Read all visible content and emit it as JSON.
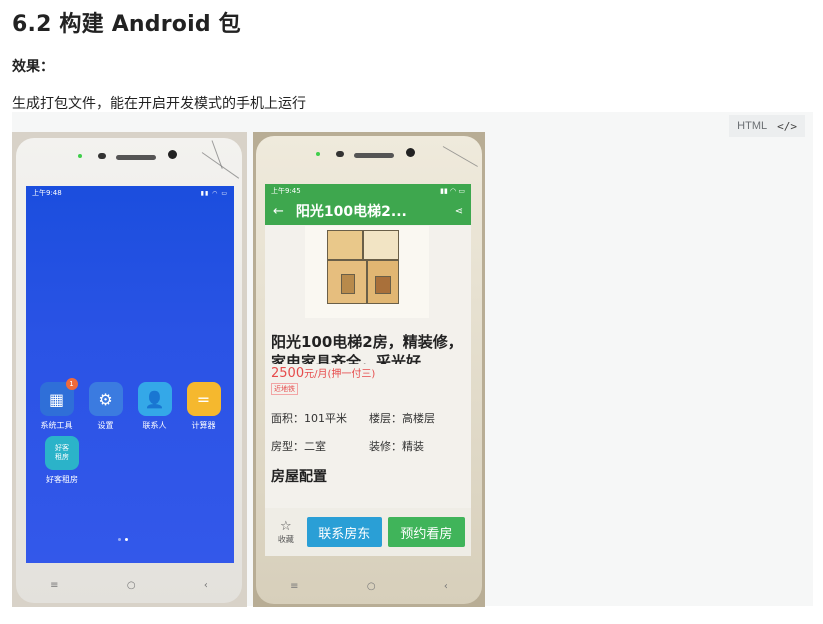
{
  "doc": {
    "heading": "6.2 构建 Android 包",
    "para1": "效果：",
    "para2": "生成打包文件，能在开启开发模式的手机上运行"
  },
  "code_badge": {
    "label": "HTML",
    "icon": "code-icon",
    "icon_glyph": "</>"
  },
  "phone1": {
    "status_time": "上午9:48",
    "status_icons": "▮▮ ◠ ▭",
    "apps_row1": [
      {
        "label": "系统工具",
        "icon": "grid-icon",
        "glyph": "▦",
        "color": "#2f6fd8",
        "badge": "1"
      },
      {
        "label": "设置",
        "icon": "gear-icon",
        "glyph": "⚙",
        "color": "#3b7be0"
      },
      {
        "label": "联系人",
        "icon": "person-icon",
        "glyph": "👤",
        "color": "#34a8e8"
      },
      {
        "label": "计算器",
        "icon": "calculator-icon",
        "glyph": "=",
        "color": "#f5b82e"
      }
    ],
    "apps_row2": [
      {
        "label": "好客租房",
        "icon": "house-rental-icon",
        "glyph": "好客\n租房",
        "color": "#2bb3c9"
      }
    ],
    "nav": [
      "≡",
      "○",
      "‹"
    ]
  },
  "phone2": {
    "status_time": "上午9:45",
    "status_icons": "▮▮ ◠ ▭",
    "appbar_title": "阳光100电梯2...",
    "back_glyph": "←",
    "share_glyph": "⋖",
    "house_title": "阳光100电梯2房，精装修，\n家电家具齐全，采光好",
    "price": "2500",
    "price_unit": "元/月(押一付三)",
    "tag": "近地铁",
    "info": {
      "area_label": "面积：101平米",
      "floor_label": "楼层：高楼层",
      "type_label": "房型：二室",
      "decor_label": "装修：精装"
    },
    "section_title": "房屋配置",
    "fav_glyph": "☆",
    "fav_label": "收藏",
    "contact_button": "联系房东",
    "book_button": "预约看房",
    "nav": [
      "≡",
      "○",
      "‹"
    ]
  }
}
